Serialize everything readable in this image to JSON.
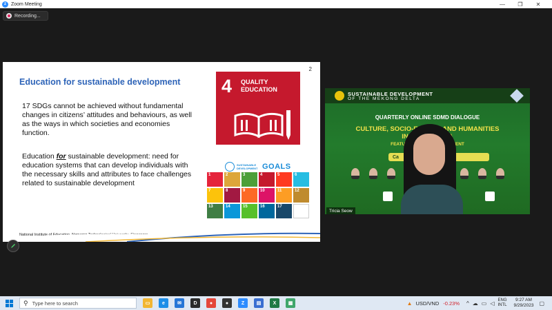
{
  "window": {
    "title": "Zoom Meeting",
    "controls": [
      "—",
      "❐",
      "✕"
    ]
  },
  "recording": {
    "label": "Recording..."
  },
  "slide": {
    "number": "2",
    "title": "Education for sustainable development",
    "paragraph1": "17 SDGs cannot be achieved without fundamental changes in citizens’ attitudes and behaviours, as well as the ways in which societies and economies function.",
    "paragraph2_before": "Education ",
    "paragraph2_em": "for",
    "paragraph2_after": " sustainable development: need for education systems that can develop individuals with the necessary skills and attributes to face challenges related to sustainable development",
    "footer": "National Institute of Education, Nanyang Technological University, Singapore",
    "sdg4": {
      "number": "4",
      "label": "QUALITY EDUCATION"
    },
    "goals_logo": {
      "small": "SUSTAINABLE DEVELOPMENT",
      "big": "GOALS"
    },
    "sdg_tiles": [
      {
        "n": "1",
        "c": "#e5243b"
      },
      {
        "n": "2",
        "c": "#dda63a"
      },
      {
        "n": "3",
        "c": "#4c9f38"
      },
      {
        "n": "4",
        "c": "#c5192d"
      },
      {
        "n": "5",
        "c": "#ff3a21"
      },
      {
        "n": "6",
        "c": "#26bde2"
      },
      {
        "n": "7",
        "c": "#fcc30b"
      },
      {
        "n": "8",
        "c": "#a21942"
      },
      {
        "n": "9",
        "c": "#fd6925"
      },
      {
        "n": "10",
        "c": "#dd1367"
      },
      {
        "n": "11",
        "c": "#fd9d24"
      },
      {
        "n": "12",
        "c": "#bf8b2e"
      },
      {
        "n": "13",
        "c": "#3f7e44"
      },
      {
        "n": "14",
        "c": "#0a97d9"
      },
      {
        "n": "15",
        "c": "#56c02b"
      },
      {
        "n": "16",
        "c": "#00689d"
      },
      {
        "n": "17",
        "c": "#19486a"
      },
      {
        "n": "",
        "c": "#ffffff"
      }
    ]
  },
  "video": {
    "header_line1": "SUSTAINABLE DEVELOPMENT",
    "header_line2": "OF THE MEKONG DELTA",
    "event": "QUARTERLY ONLINE SDMD DIALOGUE",
    "theme_line1": "CULTURE, SOCIO-E          C AND HUMANITIES",
    "theme_line2": "IN T          DELTA",
    "feature": "FEATURE                    VELOPMENT",
    "date_pill": "Ca                2023",
    "participant_name": "Tricia Seow"
  },
  "taskbar": {
    "search_placeholder": "Type here to search",
    "fx_pair": "USD/VND",
    "fx_change": "-0.23%",
    "lang_top": "ENG",
    "lang_bottom": "INTL",
    "time": "9:27 AM",
    "date": "9/29/2023",
    "apps": [
      {
        "name": "file-explorer",
        "c": "#f2b632",
        "g": "▭"
      },
      {
        "name": "edge",
        "c": "#1d8ee8",
        "g": "e"
      },
      {
        "name": "mail",
        "c": "#2676d6",
        "g": "✉"
      },
      {
        "name": "dell",
        "c": "#2a2a2a",
        "g": "D"
      },
      {
        "name": "chrome",
        "c": "#e4473a",
        "g": "●"
      },
      {
        "name": "app-dark",
        "c": "#333333",
        "g": "●"
      },
      {
        "name": "zoom",
        "c": "#2d8cff",
        "g": "Z"
      },
      {
        "name": "app-doc",
        "c": "#3a6fd1",
        "g": "▤"
      },
      {
        "name": "excel",
        "c": "#1f7a45",
        "g": "X"
      },
      {
        "name": "app-green",
        "c": "#3fa66b",
        "g": "▦"
      }
    ]
  },
  "colors": {
    "slide_title": "#2e64b8",
    "sdg4_red": "#c5192d",
    "recording_dot": "#e0245e",
    "fx_negative": "#d0202a",
    "taskbar": "#dfe8f3"
  }
}
